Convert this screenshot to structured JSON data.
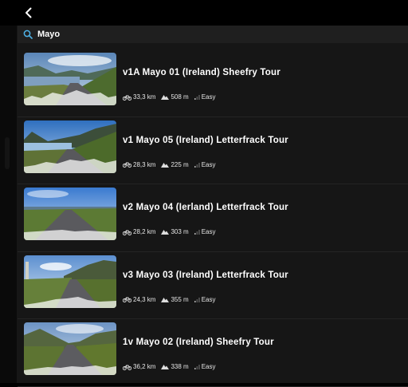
{
  "search": {
    "value": "Mayo"
  },
  "routes": [
    {
      "title": "v1A Mayo 01 (Ireland) Sheefry Tour",
      "distance": "33,3 km",
      "elevation": "508 m",
      "difficulty": "Easy"
    },
    {
      "title": "v1 Mayo 05 (Ireland) Letterfrack Tour",
      "distance": "28,3 km",
      "elevation": "225 m",
      "difficulty": "Easy"
    },
    {
      "title": "v2 Mayo 04 (Ierland) Letterfrack Tour",
      "distance": "28,2 km",
      "elevation": "303 m",
      "difficulty": "Easy"
    },
    {
      "title": "v3 Mayo 03 (Ireland) Letterfrack Tour",
      "distance": "24,3 km",
      "elevation": "355 m",
      "difficulty": "Easy"
    },
    {
      "title": "1v Mayo 02 (Ireland) Sheefry Tour",
      "distance": "36,2 km",
      "elevation": "338 m",
      "difficulty": "Easy"
    }
  ],
  "icons": {
    "back": "chevron-left-icon",
    "search": "search-icon",
    "distance": "bicycle-icon",
    "elevation": "mountain-icon",
    "difficulty": "difficulty-bars-icon"
  },
  "colors": {
    "accent": "#4fb3e8",
    "background": "#161616",
    "text": "#ffffff"
  }
}
